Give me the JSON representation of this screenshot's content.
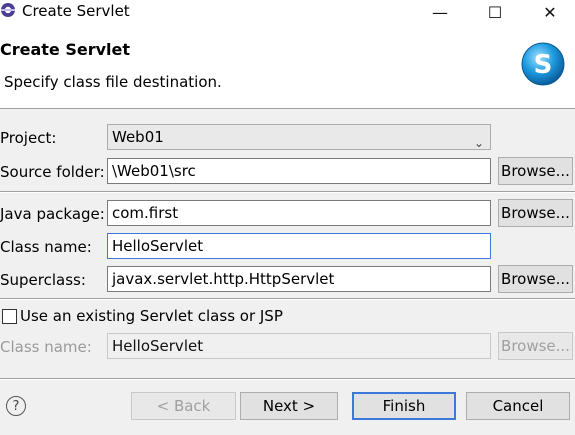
{
  "window": {
    "title": "Create Servlet",
    "controls": {
      "minimize": "—",
      "maximize": "☐",
      "close": "✕"
    }
  },
  "header": {
    "title": "Create Servlet",
    "description": "Specify class file destination."
  },
  "form": {
    "project": {
      "label": "Project:",
      "value": "Web01"
    },
    "source_folder": {
      "label": "Source folder:",
      "value": "\\Web01\\src",
      "button": "Browse..."
    },
    "java_package": {
      "label": "Java package:",
      "value": "com.first",
      "button": "Browse..."
    },
    "class_name": {
      "label": "Class name:",
      "value": "HelloServlet"
    },
    "superclass": {
      "label": "Superclass:",
      "value": "javax.servlet.http.HttpServlet",
      "button": "Browse..."
    },
    "use_existing": {
      "label": "Use an existing Servlet class or JSP",
      "checked": false
    },
    "existing_class_name": {
      "label": "Class name:",
      "value": "HelloServlet",
      "button": "Browse..."
    }
  },
  "footer": {
    "help": "?",
    "back": "< Back",
    "next": "Next >",
    "finish": "Finish",
    "cancel": "Cancel"
  },
  "colors": {
    "focus": "#3c78d8",
    "banner": "#ffffff",
    "dialog": "#f0f0f0"
  }
}
